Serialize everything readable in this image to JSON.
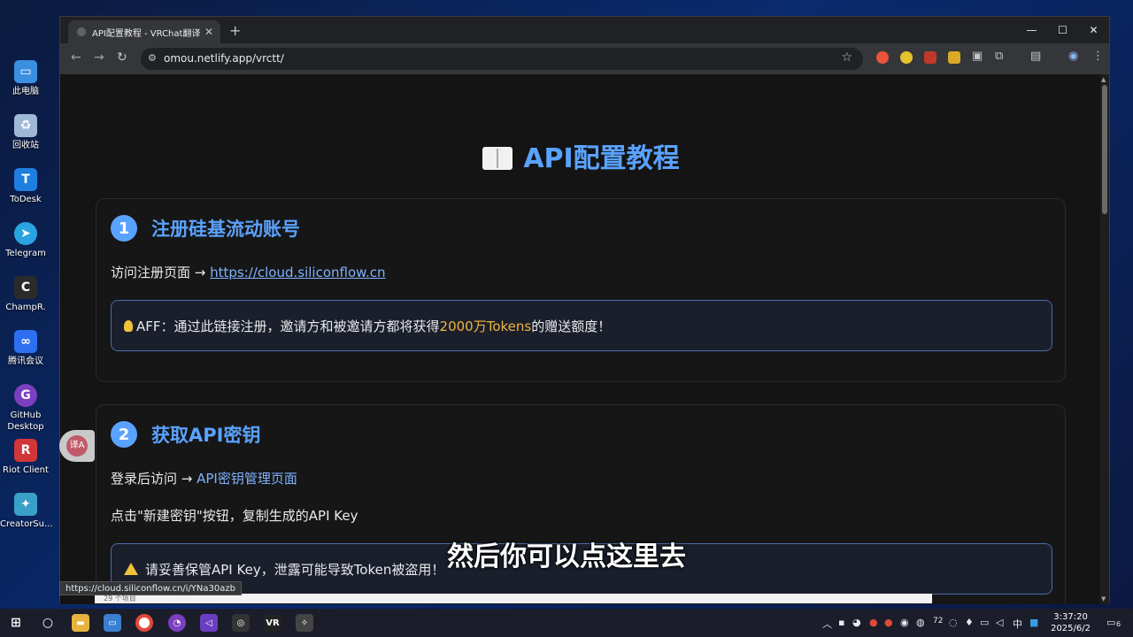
{
  "desktop": {
    "icons": [
      {
        "label": "此电脑",
        "icon": "computer-icon",
        "color": "#3b8fe0"
      },
      {
        "label": "回收站",
        "icon": "recycle-bin-icon",
        "color": "#9fb8d8"
      },
      {
        "label": "ToDesk",
        "icon": "todesk-icon",
        "color": "#1e7fe0"
      },
      {
        "label": "Telegram",
        "icon": "telegram-icon",
        "color": "#2aa3e0"
      },
      {
        "label": "ChampR.",
        "icon": "champr-icon",
        "color": "#2a2a2a"
      },
      {
        "label": "腾讯会议",
        "icon": "tencent-meeting-icon",
        "color": "#2d6ff0"
      },
      {
        "label": "GitHub Desktop",
        "icon": "github-desktop-icon",
        "color": "#7b3fbf"
      },
      {
        "label": "Riot Client",
        "icon": "riot-client-icon",
        "color": "#d13639"
      },
      {
        "label": "CreatorSu...",
        "icon": "creatorsuite-icon",
        "color": "#3aa0c8"
      }
    ]
  },
  "browser": {
    "tab_title": "API配置教程 - VRChat翻译工具",
    "url": "omou.netlify.app/vrctt/",
    "status_url": "https://cloud.siliconflow.cn/i/YNa30azb"
  },
  "page": {
    "title": "API配置教程",
    "section1": {
      "number": "1",
      "heading": "注册硅基流动账号",
      "visit_prefix": "访问注册页面 → ",
      "visit_link": "https://cloud.siliconflow.cn",
      "note_prefix": "AFF：通过此链接注册，邀请方和被邀请方都将获得",
      "note_highlight": "2000万Tokens",
      "note_suffix": "的赠送额度！"
    },
    "section2": {
      "number": "2",
      "heading": "获取API密钥",
      "login_prefix": "登录后访问 → ",
      "login_link": "API密钥管理页面",
      "instruction": "点击\"新建密钥\"按钮，复制生成的API Key",
      "warning": "请妥善保管API Key，泄露可能导致Token被盗用！"
    }
  },
  "subtitle": "然后你可以点这里去",
  "explorer_status": "29 个项目",
  "taskbar": {
    "temp": "72",
    "ime": "中",
    "time": "3:37:20",
    "date": "2025/6/2",
    "notification_count": "6"
  }
}
